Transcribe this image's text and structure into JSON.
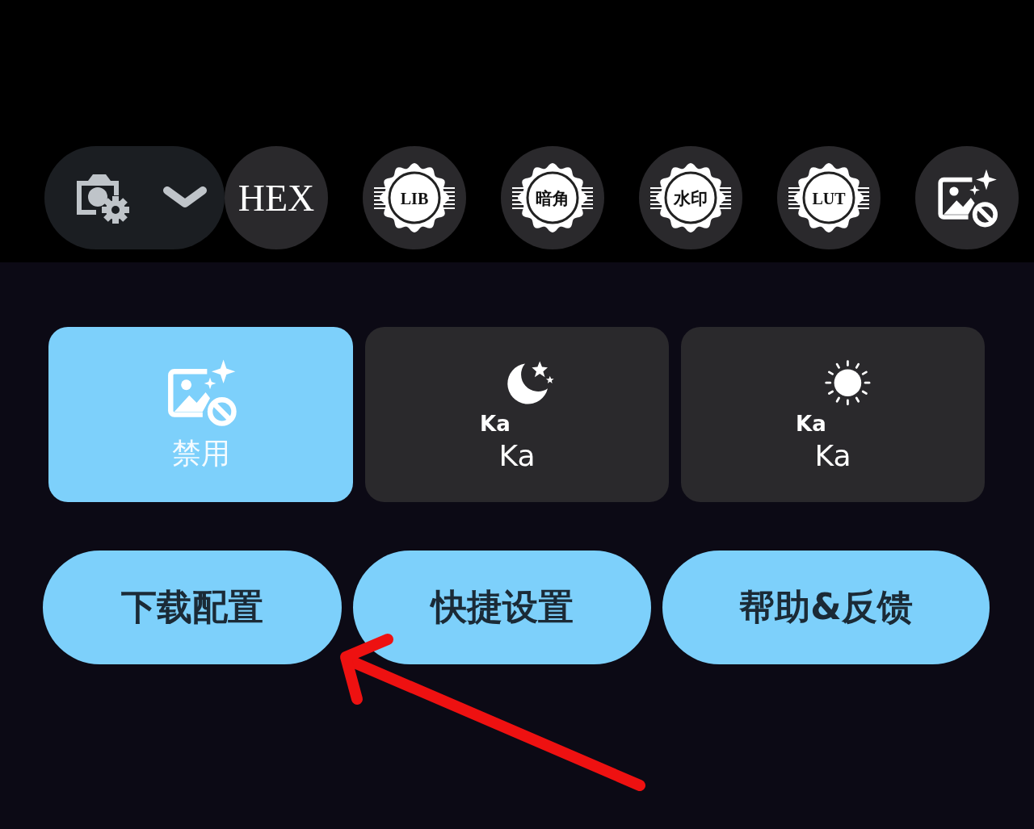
{
  "toolbar": {
    "hex_label": "HEX",
    "filters": [
      {
        "kind": "seal",
        "label": "LIB"
      },
      {
        "kind": "seal",
        "label": "暗角"
      },
      {
        "kind": "seal",
        "label": "水印"
      },
      {
        "kind": "seal",
        "label": "LUT"
      },
      {
        "kind": "no-image"
      }
    ]
  },
  "modes": [
    {
      "kind": "disabled",
      "label": "禁用",
      "selected": true
    },
    {
      "kind": "night",
      "badge": "Ka",
      "label": "Ka",
      "selected": false
    },
    {
      "kind": "day",
      "badge": "Ka",
      "label": "Ka",
      "selected": false
    }
  ],
  "buttons": [
    "下载配置",
    "快捷设置",
    "帮助&反馈"
  ]
}
